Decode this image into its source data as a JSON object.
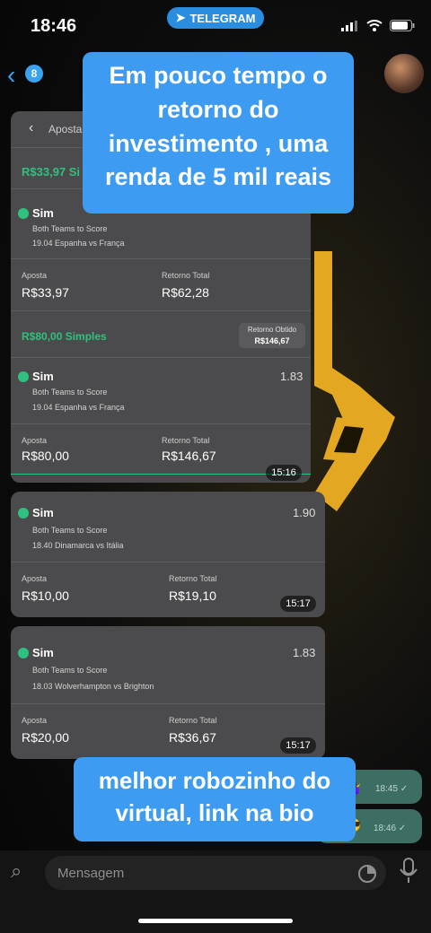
{
  "status": {
    "time": "18:46",
    "app_pill": "TELEGRAM"
  },
  "topbar": {
    "badge_count": "8"
  },
  "captions": {
    "top": "Em pouco tempo o retorno do investimento , uma renda de 5 mil reais",
    "bottom": "melhor robozinho do virtual, link na bio"
  },
  "card1": {
    "header_title": "Aposta",
    "bet1": {
      "title": "R$33,97 Si",
      "selection": "Sim",
      "market": "Both Teams to Score",
      "match": "19.04 Espanha vs França",
      "stake_label": "Aposta",
      "stake": "R$33,97",
      "return_label": "Retorno Total",
      "return": "R$62,28"
    },
    "bet2": {
      "title": "R$80,00 Simples",
      "badge_label": "Retorno Obtido",
      "badge_value": "R$146,67",
      "selection": "Sim",
      "odd": "1.83",
      "market": "Both Teams to Score",
      "match": "19.04 Espanha vs França",
      "stake_label": "Aposta",
      "stake": "R$80,00",
      "return_label": "Retorno Total",
      "return": "R$146,67"
    },
    "time": "15:16"
  },
  "card2": {
    "selection": "Sim",
    "odd": "1.90",
    "market": "Both Teams to Score",
    "match": "18.40 Dinamarca vs Itália",
    "stake_label": "Aposta",
    "stake": "R$10,00",
    "return_label": "Retorno Total",
    "return": "R$19,10",
    "time": "15:17"
  },
  "card3": {
    "selection": "Sim",
    "odd": "1.83",
    "market": "Both Teams to Score",
    "match": "18.03 Wolverhampton vs Brighton",
    "stake_label": "Aposta",
    "stake": "R$20,00",
    "return_label": "Retorno Total",
    "return": "R$36,67",
    "time": "15:17"
  },
  "outgoing": [
    {
      "text": "🤷‍♀️",
      "time": "18:45 ✓"
    },
    {
      "text": "or 😎",
      "time": "18:46 ✓"
    }
  ],
  "input": {
    "placeholder": "Mensagem"
  }
}
